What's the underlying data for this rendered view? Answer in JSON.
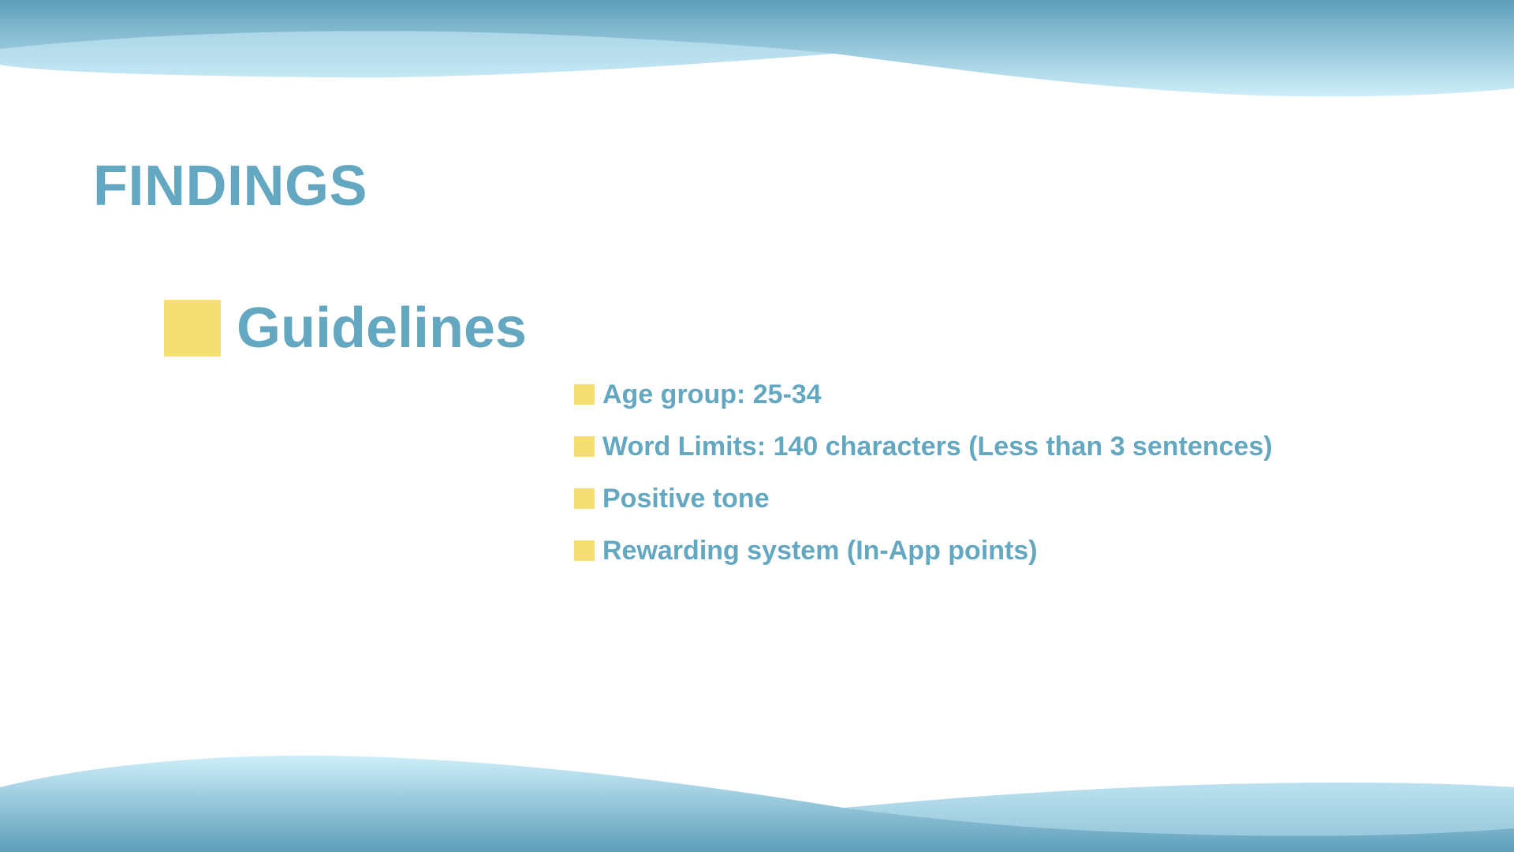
{
  "slide": {
    "title": "FINDINGS",
    "section_title": "Guidelines",
    "bullets": [
      "Age group: 25-34",
      "Word Limits: 140 characters (Less than 3 sentences)",
      "Positive tone",
      "Rewarding system (In-App points)"
    ]
  },
  "colors": {
    "text": "#64a7c1",
    "accent": "#f5df74",
    "wave_dark": "#5e9fbb",
    "wave_light": "#cdeef9",
    "background": "#ffffff"
  }
}
